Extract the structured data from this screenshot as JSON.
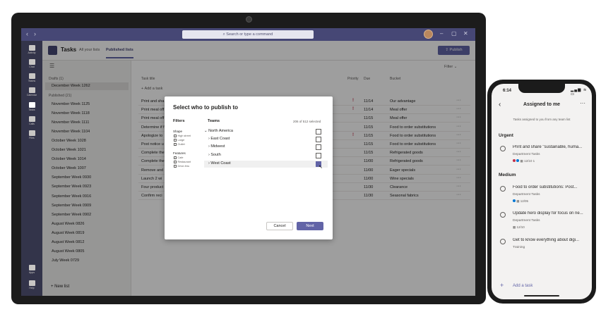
{
  "desktop": {
    "search_placeholder": "Search or type a command",
    "rail": [
      "Activity",
      "Chat",
      "Teams",
      "Calendar",
      "Tasks",
      "Calls",
      "Files"
    ],
    "rail_bottom": [
      "Apps",
      "Help"
    ],
    "app_title": "Tasks",
    "tabs": [
      "All your lists",
      "Published lists"
    ],
    "publish_label": "Publish",
    "filter_label": "Filter",
    "sidebar": {
      "drafts_header": "Drafts (1)",
      "draft_item": "December Week 1262",
      "published_header": "Published (21)",
      "published_items": [
        "November Week 1125",
        "November Week 1118",
        "November Week 1111",
        "November Week 1104",
        "October Week 1028",
        "October Week 1021",
        "October Week 1014",
        "October Week 1007",
        "September Week 0930",
        "September Week 0923",
        "September Week 0916",
        "September Week 0909",
        "September Week 0902",
        "August Week 0826",
        "August Week 0819",
        "August Week 0812",
        "August Week 0805",
        "July Week 0729"
      ],
      "new_list": "New list"
    },
    "table": {
      "headers": [
        "Task title",
        "Priority",
        "Due",
        "Bucket"
      ],
      "add_task": "Add a task",
      "rows": [
        {
          "title": "Print and sha",
          "priority": "!",
          "due": "11/14",
          "bucket": "Our advantage"
        },
        {
          "title": "Print meal off",
          "priority": "!",
          "due": "11/14",
          "bucket": "Meal offer"
        },
        {
          "title": "Print meal off",
          "priority": "",
          "due": "11/15",
          "bucket": "Meal offer"
        },
        {
          "title": "Determine if f",
          "priority": "",
          "due": "11/15",
          "bucket": "Food to order substitutions"
        },
        {
          "title": "Apologize to",
          "priority": "!",
          "due": "11/15",
          "bucket": "Food to order substitutions"
        },
        {
          "title": "Post notice u",
          "priority": "",
          "due": "11/15",
          "bucket": "Food to order substitutions"
        },
        {
          "title": "Complete the",
          "priority": "",
          "due": "11/15",
          "bucket": "Refrigerated goods"
        },
        {
          "title": "Complete the",
          "priority": "",
          "due": "11/00",
          "bucket": "Refrigerated goods"
        },
        {
          "title": "Remove and",
          "priority": "",
          "due": "11/00",
          "bucket": "Eager specials"
        },
        {
          "title": "Launch 2 wi",
          "priority": "",
          "due": "11/00",
          "bucket": "Wine specials"
        },
        {
          "title": "Four product",
          "priority": "",
          "due": "11/30",
          "bucket": "Clearance"
        },
        {
          "title": "Confirm reci",
          "priority": "",
          "due": "11/30",
          "bucket": "Seasonal fabrics"
        }
      ]
    },
    "dialog": {
      "title": "Select who to publish to",
      "filters_header": "Filters",
      "shape_header": "Shape",
      "shape_options": [
        "High street",
        "Large",
        "Outlet"
      ],
      "features_header": "Features",
      "feature_options": [
        "Cafe",
        "Restaurant",
        "Drive-thru"
      ],
      "teams_header": "Teams",
      "selected_count": "206 of 512 selected",
      "teams": [
        {
          "name": "North America",
          "checked": false
        },
        {
          "name": "East Coast",
          "checked": false
        },
        {
          "name": "Midwest",
          "checked": false
        },
        {
          "name": "South",
          "checked": false
        },
        {
          "name": "West Coast",
          "checked": true
        }
      ],
      "cancel_label": "Cancel",
      "next_label": "Next"
    }
  },
  "phone": {
    "time": "6:14",
    "status": "▂▄▆ ≋ ▭",
    "title": "Assigned to me",
    "subtitle": "Tasks assigned to you from any team list",
    "sections": [
      {
        "name": "Urgent",
        "tasks": [
          {
            "title": "Print and share \"sustainable, huma...",
            "bucket": "Department Tasks",
            "meta": "12/10   1"
          }
        ]
      },
      {
        "name": "Medium",
        "tasks": [
          {
            "title": "Food to order substitutions: Post...",
            "bucket": "Department Tasks",
            "meta": "12/05"
          },
          {
            "title": "Update hero display for focus on ne...",
            "bucket": "Department Tasks",
            "meta": "12/10"
          },
          {
            "title": "Get to know everything about digi...",
            "bucket": "Training",
            "meta": ""
          }
        ]
      }
    ],
    "add_task": "Add a task"
  },
  "colors": {
    "accent": "#6264a7",
    "topbar": "#464775",
    "rail": "#33344a",
    "priority": "#c4314b"
  }
}
